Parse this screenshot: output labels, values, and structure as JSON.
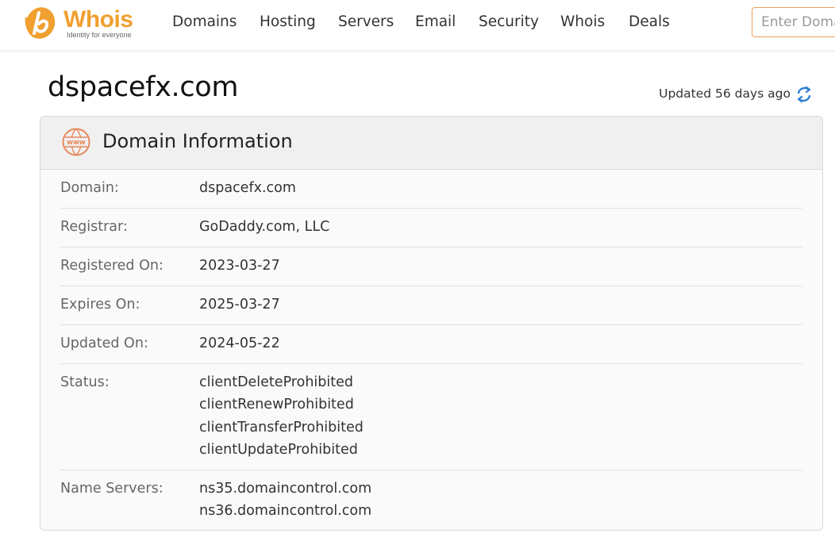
{
  "header": {
    "logo": {
      "word": "Whois",
      "tagline": "Identity for everyone"
    },
    "nav": [
      "Domains",
      "Hosting",
      "Servers",
      "Email",
      "Security",
      "Whois",
      "Deals"
    ],
    "search": {
      "placeholder": "Enter Domain"
    }
  },
  "page": {
    "title": "dspacefx.com",
    "updated": "Updated 56 days ago"
  },
  "card": {
    "title": "Domain Information",
    "rows": [
      {
        "label": "Domain:",
        "values": [
          "dspacefx.com"
        ]
      },
      {
        "label": "Registrar:",
        "values": [
          "GoDaddy.com, LLC"
        ]
      },
      {
        "label": "Registered On:",
        "values": [
          "2023-03-27"
        ]
      },
      {
        "label": "Expires On:",
        "values": [
          "2025-03-27"
        ]
      },
      {
        "label": "Updated On:",
        "values": [
          "2024-05-22"
        ]
      },
      {
        "label": "Status:",
        "values": [
          "clientDeleteProhibited",
          "clientRenewProhibited",
          "clientTransferProhibited",
          "clientUpdateProhibited"
        ]
      },
      {
        "label": "Name Servers:",
        "values": [
          "ns35.domaincontrol.com",
          "ns36.domaincontrol.com"
        ]
      }
    ]
  },
  "icons": {
    "logo": "whois-logo-icon",
    "refresh": "refresh-icon",
    "section": "www-globe-icon"
  },
  "colors": {
    "brand_orange": "#f0a030",
    "icon_orange": "#e8885a",
    "refresh_blue": "#2f7fd6"
  }
}
